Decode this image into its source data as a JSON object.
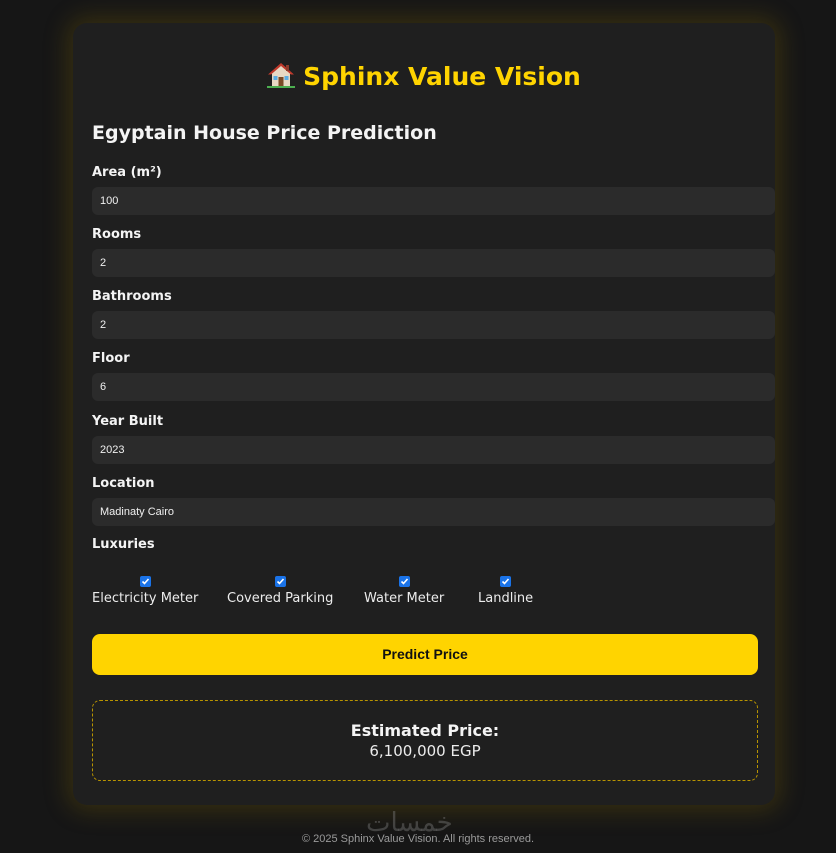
{
  "app": {
    "title": "Sphinx Value Vision",
    "subtitle": "Egyptain House Price Prediction",
    "accent_color": "#ffd400",
    "icon": "house-icon"
  },
  "form": {
    "area_label": "Area (m²)",
    "area_value": "100",
    "rooms_label": "Rooms",
    "rooms_value": "2",
    "bathrooms_label": "Bathrooms",
    "bathrooms_value": "2",
    "floor_label": "Floor",
    "floor_value": "6",
    "year_label": "Year Built",
    "year_value": "2023",
    "location_label": "Location",
    "location_value": "Madinaty Cairo"
  },
  "luxuries": {
    "label": "Luxuries",
    "items": [
      {
        "label": "Electricity Meter",
        "checked": true
      },
      {
        "label": "Covered Parking",
        "checked": true
      },
      {
        "label": "Water Meter",
        "checked": true
      },
      {
        "label": "Landline",
        "checked": true
      }
    ]
  },
  "predict_label": "Predict Price",
  "result": {
    "title": "Estimated Price:",
    "value": "6,100,000 EGP"
  },
  "footer": "© 2025 Sphinx Value Vision. All rights reserved.",
  "watermark": "خمسات"
}
